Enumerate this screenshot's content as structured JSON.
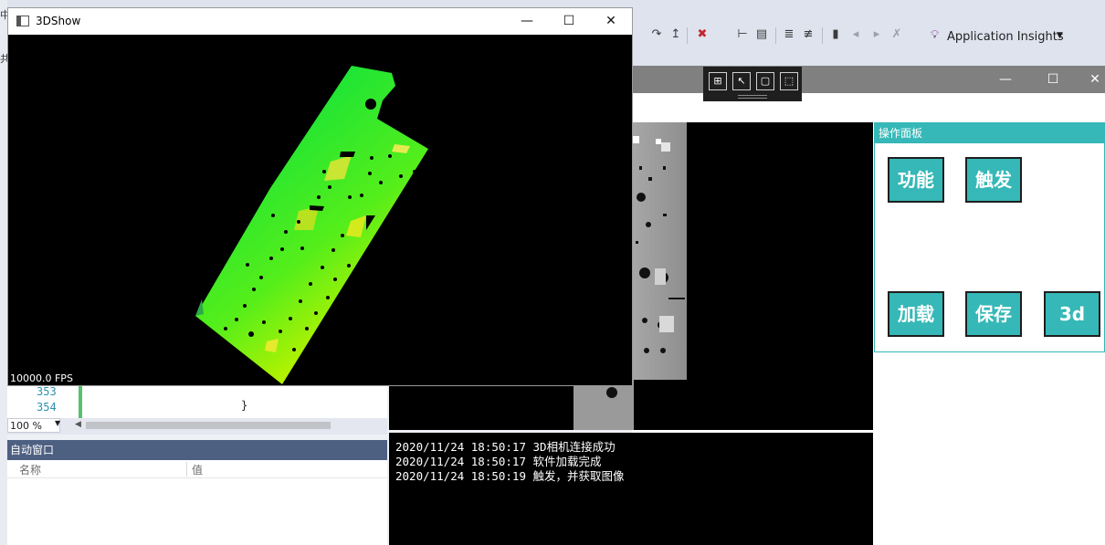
{
  "vs": {
    "toolbar": {
      "application_insights_label": "Application Insights",
      "icons": [
        "redo-icon",
        "step-icon",
        "breakpoint-icon",
        "pin-icon",
        "collapse-icon",
        "comment-icon",
        "uncomment-icon",
        "bookmark-icon",
        "bookmark-prev-icon",
        "bookmark-next-icon",
        "bookmark-clear-icon",
        "application-insights-icon"
      ]
    },
    "left_strip_glyphs": [
      "中",
      "共"
    ],
    "editor": {
      "line_numbers": [
        "353",
        "354"
      ],
      "code_line": "}",
      "zoom": "100 %"
    },
    "autos": {
      "title": "自动窗口",
      "columns": [
        "名称",
        "值"
      ]
    }
  },
  "show_window": {
    "title": "3DShow",
    "fps": "10000.0 FPS",
    "controls": {
      "minimize": "—",
      "maximize": "☐",
      "close": "✕"
    }
  },
  "main_window": {
    "controls": {
      "minimize": "—",
      "maximize": "☐",
      "close": "✕"
    },
    "floating_toolbar": [
      "select-element-icon",
      "pointer-icon",
      "frame-icon",
      "track-focus-icon"
    ],
    "log": [
      "2020/11/24 18:50:17 3D相机连接成功",
      "2020/11/24 18:50:17 软件加载完成",
      "2020/11/24 18:50:19 触发，并获取图像"
    ],
    "panel": {
      "title": "操作面板",
      "buttons": {
        "function": "功能",
        "trigger": "触发",
        "load": "加载",
        "save": "保存",
        "three_d": "3d"
      }
    }
  }
}
